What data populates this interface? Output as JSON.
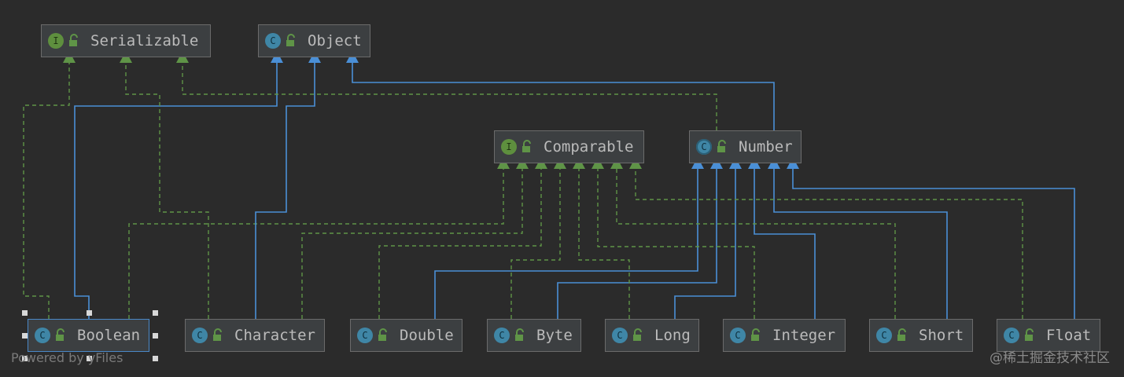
{
  "nodes": {
    "serializable": {
      "name": "Serializable",
      "kind": "interface",
      "badge": "I"
    },
    "object": {
      "name": "Object",
      "kind": "class",
      "badge": "C"
    },
    "comparable": {
      "name": "Comparable",
      "kind": "interface",
      "badge": "I"
    },
    "number": {
      "name": "Number",
      "kind": "abstract-class",
      "badge": "C"
    },
    "boolean": {
      "name": "Boolean",
      "kind": "class",
      "badge": "C"
    },
    "character": {
      "name": "Character",
      "kind": "class",
      "badge": "C"
    },
    "double": {
      "name": "Double",
      "kind": "class",
      "badge": "C"
    },
    "byte": {
      "name": "Byte",
      "kind": "class",
      "badge": "C"
    },
    "long": {
      "name": "Long",
      "kind": "class",
      "badge": "C"
    },
    "integer": {
      "name": "Integer",
      "kind": "class",
      "badge": "C"
    },
    "short": {
      "name": "Short",
      "kind": "class",
      "badge": "C"
    },
    "float": {
      "name": "Float",
      "kind": "class",
      "badge": "C"
    }
  },
  "edges": [
    {
      "from": "boolean",
      "to": "serializable",
      "type": "implements"
    },
    {
      "from": "boolean",
      "to": "object",
      "type": "extends"
    },
    {
      "from": "boolean",
      "to": "comparable",
      "type": "implements"
    },
    {
      "from": "character",
      "to": "serializable",
      "type": "implements"
    },
    {
      "from": "character",
      "to": "object",
      "type": "extends"
    },
    {
      "from": "character",
      "to": "comparable",
      "type": "implements"
    },
    {
      "from": "number",
      "to": "serializable",
      "type": "implements"
    },
    {
      "from": "number",
      "to": "object",
      "type": "extends"
    },
    {
      "from": "double",
      "to": "comparable",
      "type": "implements"
    },
    {
      "from": "double",
      "to": "number",
      "type": "extends"
    },
    {
      "from": "byte",
      "to": "comparable",
      "type": "implements"
    },
    {
      "from": "byte",
      "to": "number",
      "type": "extends"
    },
    {
      "from": "long",
      "to": "comparable",
      "type": "implements"
    },
    {
      "from": "long",
      "to": "number",
      "type": "extends"
    },
    {
      "from": "integer",
      "to": "comparable",
      "type": "implements"
    },
    {
      "from": "integer",
      "to": "number",
      "type": "extends"
    },
    {
      "from": "short",
      "to": "comparable",
      "type": "implements"
    },
    {
      "from": "short",
      "to": "number",
      "type": "extends"
    },
    {
      "from": "float",
      "to": "comparable",
      "type": "implements"
    },
    {
      "from": "float",
      "to": "number",
      "type": "extends"
    }
  ],
  "selected_node": "Boolean",
  "watermarks": {
    "left": "Powered by yFiles",
    "right": "@稀土掘金技术社区"
  },
  "colors": {
    "background": "#2b2b2b",
    "node_fill": "#3c3f41",
    "node_border": "#6b6b6b",
    "extends_edge": "#4a8fd6",
    "implements_edge": "#5f9447",
    "selection": "#4a88c7",
    "text": "#bbbbbb"
  },
  "icons": {
    "class": "class-icon",
    "interface": "interface-icon",
    "visibility": "public-lock-icon"
  }
}
